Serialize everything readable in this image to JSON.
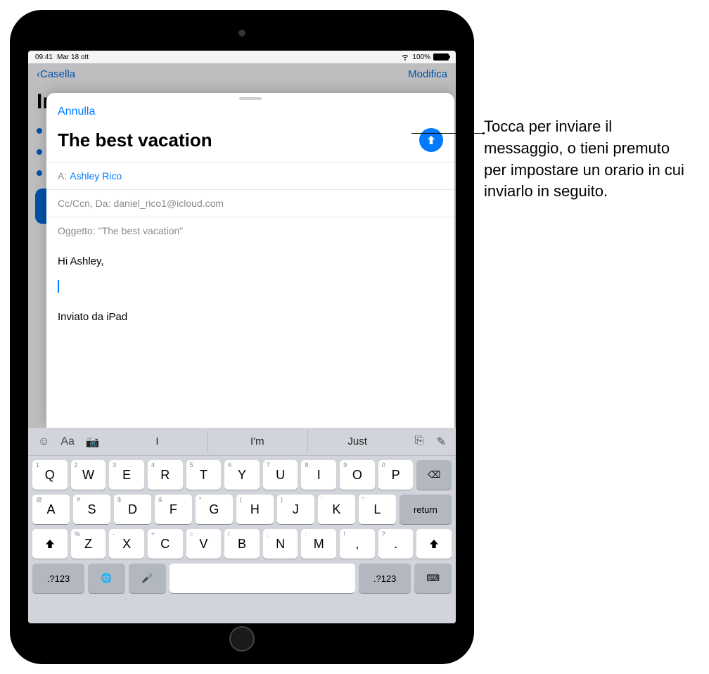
{
  "status": {
    "time": "09:41",
    "date": "Mar 18 ott",
    "battery": "100%"
  },
  "bg": {
    "back": "Casella",
    "edit": "Modifica",
    "title": "In"
  },
  "sheet": {
    "cancel": "Annulla",
    "title": "The best vacation",
    "to_label": "A:",
    "to_value": "Ashley Rico",
    "cc_label": "Cc/Ccn, Da:",
    "cc_value": "daniel_rico1@icloud.com",
    "subject_label": "Oggetto:",
    "subject_value": "\"The best vacation\"",
    "body_greeting": "Hi Ashley,",
    "signature": "Inviato da iPad"
  },
  "keyboard": {
    "suggestions": [
      "I",
      "I'm",
      "Just"
    ],
    "row1": [
      {
        "k": "Q",
        "s": "1"
      },
      {
        "k": "W",
        "s": "2"
      },
      {
        "k": "E",
        "s": "3"
      },
      {
        "k": "R",
        "s": "4"
      },
      {
        "k": "T",
        "s": "5"
      },
      {
        "k": "Y",
        "s": "6"
      },
      {
        "k": "U",
        "s": "7"
      },
      {
        "k": "I",
        "s": "8"
      },
      {
        "k": "O",
        "s": "9"
      },
      {
        "k": "P",
        "s": "0"
      }
    ],
    "row2": [
      {
        "k": "A",
        "s": "@"
      },
      {
        "k": "S",
        "s": "#"
      },
      {
        "k": "D",
        "s": "$"
      },
      {
        "k": "F",
        "s": "&"
      },
      {
        "k": "G",
        "s": "*"
      },
      {
        "k": "H",
        "s": "("
      },
      {
        "k": "J",
        "s": ")"
      },
      {
        "k": "K",
        "s": "'"
      },
      {
        "k": "L",
        "s": "\""
      }
    ],
    "row3": [
      {
        "k": "Z",
        "s": "%"
      },
      {
        "k": "X",
        "s": "-"
      },
      {
        "k": "C",
        "s": "+"
      },
      {
        "k": "V",
        "s": "="
      },
      {
        "k": "B",
        "s": "/"
      },
      {
        "k": "N",
        "s": ";"
      },
      {
        "k": "M",
        "s": ":"
      },
      {
        "k": ",",
        "s": "!"
      },
      {
        "k": ".",
        "s": "?"
      }
    ],
    "return": "return",
    "numkey": ".?123"
  },
  "callout": "Tocca per inviare il messaggio, o tieni premuto per impostare un orario in cui inviarlo in seguito."
}
